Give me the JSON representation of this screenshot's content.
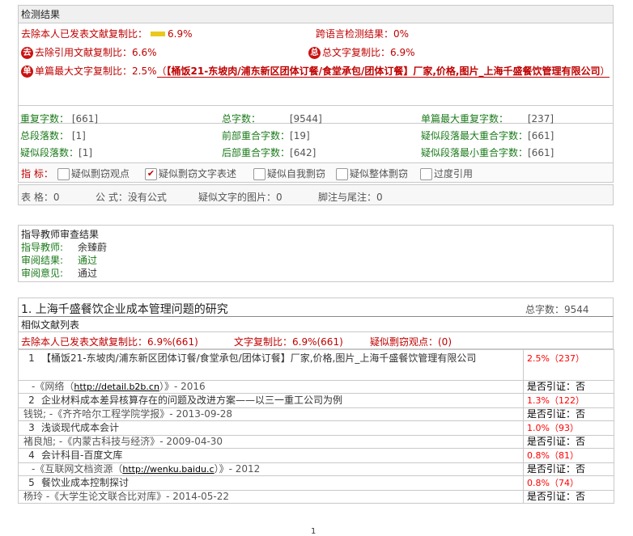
{
  "header": {
    "title": "检测结果"
  },
  "summary": {
    "excl_self_label": "去除本人已发表文献复制比：",
    "excl_self_value": "6.9%",
    "excl_self_fraction": 0.069,
    "cross_lang": "跨语言检测结果：0%",
    "excl_ref_icon": "去",
    "excl_ref": "去除引用文献复制比：6.6%",
    "total_icon": "总",
    "total": "总文字复制比：6.9%",
    "single_icon": "单",
    "single_label": "单篇最大文字复制比：2.5%",
    "single_source_open": "（",
    "single_source": "【桶饭21-东坡肉/浦东新区团体订餐/食堂承包/团体订餐】厂家,价格,图片_上海千盛餐饮管理有限公司",
    "single_source_close": "）"
  },
  "stats": [
    {
      "label": "重复字数：",
      "value": "[661]"
    },
    {
      "label": "总字数：",
      "value": "[9544]"
    },
    {
      "label": "单篇最大重复字数：",
      "value": "[237]"
    },
    {
      "label": "总段落数：",
      "value": "[1]"
    },
    {
      "label": "前部重合字数：",
      "value": "[19]"
    },
    {
      "label": "疑似段落最大重合字数：",
      "value": "[661]"
    },
    {
      "label": "疑似段落数：",
      "value": "[1]"
    },
    {
      "label": "后部重合字数：",
      "value": "[642]"
    },
    {
      "label": "疑似段落最小重合字数：",
      "value": "[661]"
    }
  ],
  "indicators": {
    "label": "指  标：",
    "items": [
      {
        "text": "疑似剽窃观点",
        "checked": false
      },
      {
        "text": "疑似剽窃文字表述",
        "checked": true
      },
      {
        "text": "疑似自我剽窃",
        "checked": false
      },
      {
        "text": "疑似整体剽窃",
        "checked": false
      },
      {
        "text": "过度引用",
        "checked": false
      }
    ]
  },
  "counts": {
    "tables": "表  格：0",
    "formulas": "公  式：没有公式",
    "images": "疑似文字的图片：0",
    "footnotes": "脚注与尾注：0"
  },
  "review": {
    "title": "指导教师审查结果",
    "teacher_label": "指导教师:",
    "teacher": "余臻蔚",
    "result_label": "审阅结果:",
    "result": "通过",
    "opinion_label": "审阅意见:",
    "opinion": "通过"
  },
  "section": {
    "title": "1. 上海千盛餐饮企业成本管理问题的研究",
    "total": "总字数：9544",
    "list_title": "相似文献列表",
    "excl": "去除本人已发表文献复制比：6.9%(661)",
    "copy": "文字复制比：6.9%(661)",
    "plag": "疑似剽窃观点：(0)"
  },
  "literature": [
    {
      "num": "1",
      "title": "【桶饭21-东坡肉/浦东新区团体订餐/食堂承包/团体订餐】厂家,价格,图片_上海千盛餐饮管理有限公司",
      "pct": "2.5%（237）",
      "src_pre": "-《网络（",
      "src_link": "http://detail.b2b.cn",
      "src_post": "）》- 2016",
      "cite": "是否引证：否"
    },
    {
      "num": "2",
      "title": "企业材料成本差异核算存在的问题及改进方案——以三一重工公司为例",
      "pct": "1.3%（122）",
      "src_pre": "钱锐; -《齐齐哈尔工程学院学报》- 2013-09-28",
      "src_link": "",
      "src_post": "",
      "cite": "是否引证：否"
    },
    {
      "num": "3",
      "title": "浅谈现代成本会计",
      "pct": "1.0%（93）",
      "src_pre": "褚良旭; -《内蒙古科技与经济》- 2009-04-30",
      "src_link": "",
      "src_post": "",
      "cite": "是否引证：否"
    },
    {
      "num": "4",
      "title": "会计科目-百度文库",
      "pct": "0.8%（81）",
      "src_pre": "-《互联网文档资源（",
      "src_link": "http://wenku.baidu.c",
      "src_post": "）》- 2012",
      "cite": "是否引证：否"
    },
    {
      "num": "5",
      "title": "餐饮业成本控制探讨",
      "pct": "0.8%（74）",
      "src_pre": "杨玲 -《大学生论文联合比对库》- 2014-05-22",
      "src_link": "",
      "src_post": "",
      "cite": "是否引证：否"
    }
  ],
  "footer": {
    "page_number": "1"
  },
  "colors": {
    "red": "#c00000",
    "green": "#1b7a1b",
    "bar": "#e8c81e",
    "link_underline": "#c00000"
  }
}
